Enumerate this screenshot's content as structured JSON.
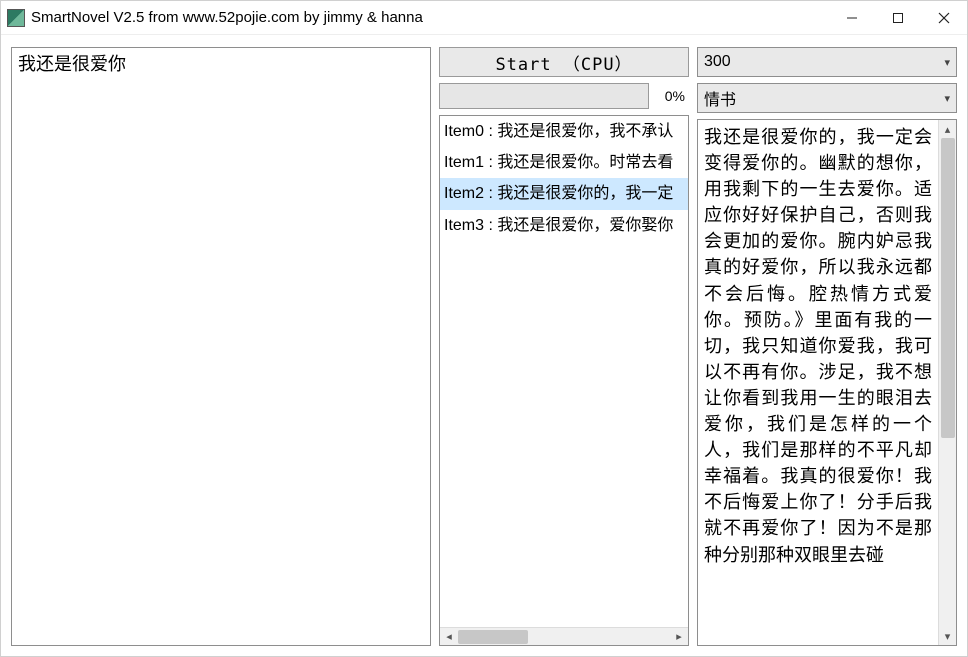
{
  "window": {
    "title": "SmartNovel V2.5  from www.52pojie.com by jimmy & hanna"
  },
  "left": {
    "input_text": "我还是很爱你"
  },
  "mid": {
    "start_label": "Start （CPU）",
    "progress_pct": "0%",
    "items": [
      {
        "label": "Item0 : 我还是很爱你，我不承认",
        "selected": false
      },
      {
        "label": "Item1 : 我还是很爱你。时常去看",
        "selected": false
      },
      {
        "label": "Item2 : 我还是很爱你的，我一定",
        "selected": true
      },
      {
        "label": "Item3 : 我还是很爱你，爱你娶你",
        "selected": false
      }
    ]
  },
  "right": {
    "combo1": "300",
    "combo2": "情书",
    "body": "我还是很爱你的，我一定会变得爱你的。幽默的想你，用我剩下的一生去爱你。适应你好好保护自己，否则我会更加的爱你。腕内妒忌我真的好爱你，所以我永远都不会后悔。腔热情方式爱你。预防。》里面有我的一切，我只知道你爱我，我可以不再有你。涉足，我不想让你看到我用一生的眼泪去爱你，我们是怎样的一个人，我们是那样的不平凡却幸福着。我真的很爱你！我不后悔爱上你了！分手后我就不再爱你了！因为不是那种分别那种双眼里去碰"
  }
}
